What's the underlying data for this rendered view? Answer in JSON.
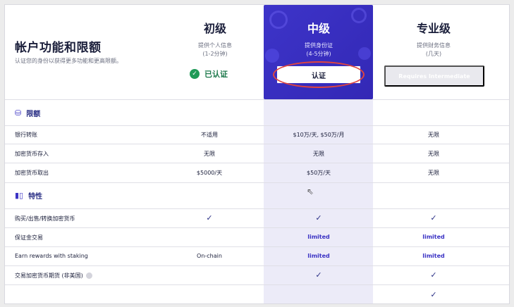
{
  "header": {
    "title": "帐户功能和限额",
    "subtitle": "认证您的身份以获得更多功能和更高限额。"
  },
  "tiers": {
    "basic": {
      "name": "初级",
      "desc": "提供个人信息",
      "time": "(1-2分钟)",
      "status": "已认证"
    },
    "intermediate": {
      "name": "中级",
      "desc": "提供身份证",
      "time": "(4-5分钟)",
      "button": "认证"
    },
    "pro": {
      "name": "专业级",
      "desc": "提供财务信息",
      "time": "(几天)",
      "button": "Requires Intermediate"
    }
  },
  "sections": {
    "limits": "限额",
    "features": "特性"
  },
  "limits_rows": [
    {
      "label": "银行转账",
      "basic": "不适用",
      "intermediate": "$10万/天, $50万/月",
      "pro": "无限"
    },
    {
      "label": "加密货币存入",
      "basic": "无限",
      "intermediate": "无限",
      "pro": "无限"
    },
    {
      "label": "加密货币取出",
      "basic": "$5000/天",
      "intermediate": "$50万/天",
      "pro": "无限"
    }
  ],
  "feature_rows": [
    {
      "label": "购买/出售/转换加密货币",
      "basic": "✓",
      "intermediate": "✓",
      "pro": "✓"
    },
    {
      "label": "保证金交易",
      "basic": "",
      "intermediate": "limited",
      "pro": "limited"
    },
    {
      "label": "Earn rewards with staking",
      "basic": "On-chain",
      "intermediate": "limited",
      "pro": "limited"
    },
    {
      "label": "交易加密货币期货 (非美国)",
      "basic": "",
      "intermediate": "✓",
      "pro": "✓"
    },
    {
      "label": "",
      "basic": "",
      "intermediate": "",
      "pro": "✓"
    }
  ],
  "colors": {
    "accent": "#3b33c4",
    "verified_green": "#1f9a57",
    "highlight_bg": "#ecebf8",
    "annotation_red": "#e0453f"
  }
}
